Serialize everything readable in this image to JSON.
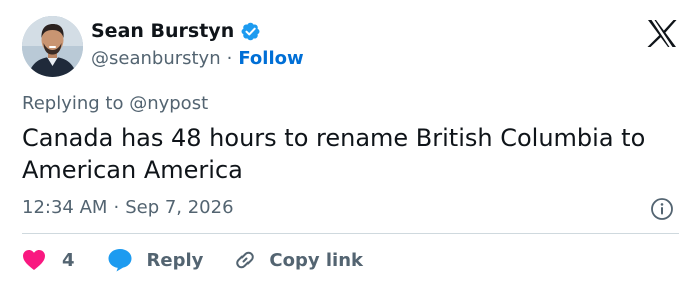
{
  "user": {
    "display_name": "Sean Burstyn",
    "handle": "@seanburstyn",
    "separator": "·",
    "follow_label": "Follow",
    "verified": true
  },
  "tweet": {
    "replying_to": "Replying to @nypost",
    "text": "Canada has 48 hours to rename British Columbia to American America",
    "time": "12:34 AM",
    "meta_separator": "·",
    "date": "Sep 7, 2026"
  },
  "actions": {
    "like_count": "4",
    "reply_label": "Reply",
    "copy_link_label": "Copy link"
  },
  "icons": {
    "verified": "verified-badge-icon",
    "logo": "x-logo-icon",
    "info": "info-icon",
    "like": "heart-icon",
    "reply": "speech-bubble-icon",
    "copy": "link-icon"
  },
  "colors": {
    "accent": "#1d9bf0",
    "follow": "#006fd6",
    "like": "#f91880",
    "text": "#0f1419",
    "muted": "#536471",
    "divider": "#cfd9de"
  }
}
